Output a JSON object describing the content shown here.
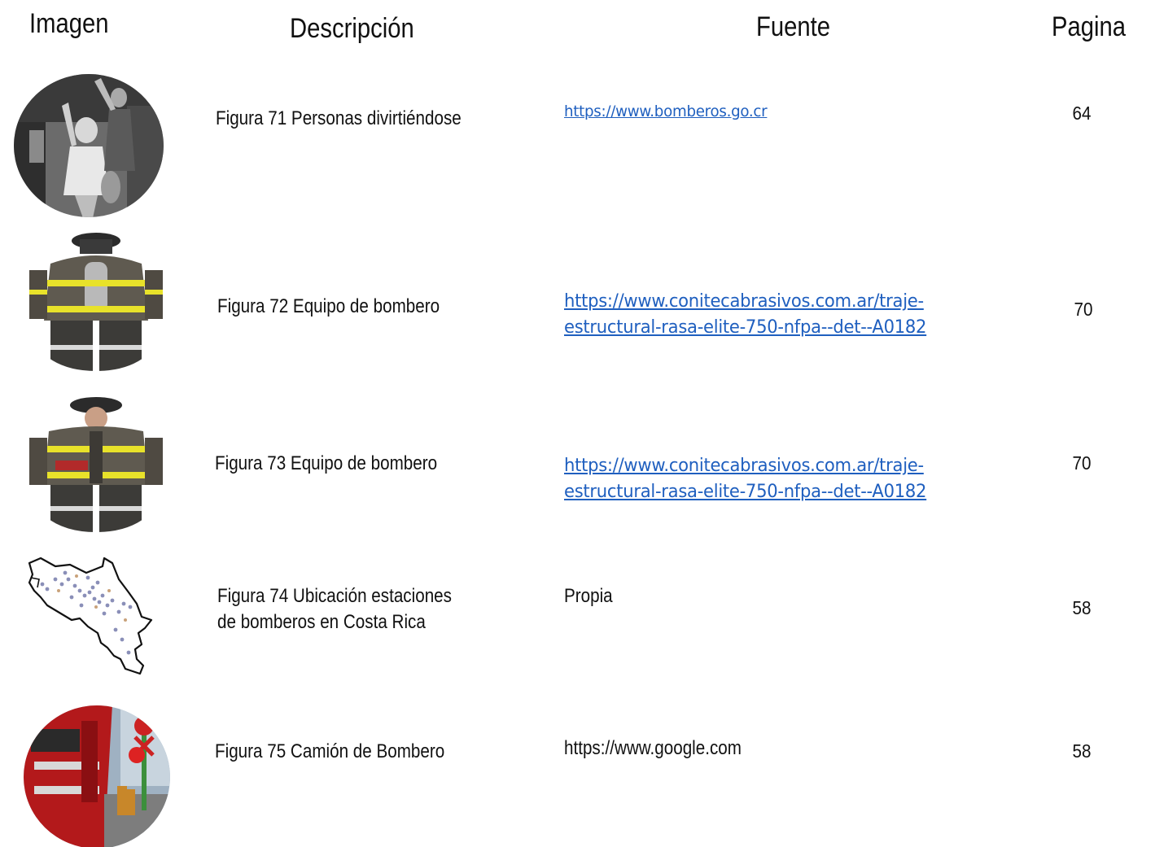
{
  "headers": {
    "image": "Imagen",
    "description": "Descripción",
    "source": "Fuente",
    "page": "Pagina"
  },
  "rows": [
    {
      "thumbnail": "people-having-fun-photo",
      "description": "Figura 71 Personas divirtiéndose",
      "source_line1": "https://www.bomberos.go.cr",
      "source_line2": "",
      "page": "64"
    },
    {
      "thumbnail": "firefighter-suit-back-photo",
      "description": "Figura 72 Equipo de bombero",
      "source_line1": "https://www.conitecabrasivos.com.ar/traje-",
      "source_line2": "estructural-rasa-elite-750-nfpa--det--A0182",
      "page": "70"
    },
    {
      "thumbnail": "firefighter-suit-front-photo",
      "description": "Figura 73 Equipo de bombero",
      "source_line1": "https://www.conitecabrasivos.com.ar/traje-",
      "source_line2": "estructural-rasa-elite-750-nfpa--det--A0182",
      "page": "70"
    },
    {
      "thumbnail": "costa-rica-stations-map",
      "description_line1": "Figura 74 Ubicación estaciones",
      "description_line2": "de bomberos en Costa Rica",
      "source": "Propia",
      "page": "58"
    },
    {
      "thumbnail": "fire-truck-photo",
      "description": "Figura 75 Camión de Bombero",
      "source": "https://www.google.com",
      "page": "58"
    }
  ],
  "colors": {
    "link": "#1f5fbf",
    "text": "#111111"
  }
}
